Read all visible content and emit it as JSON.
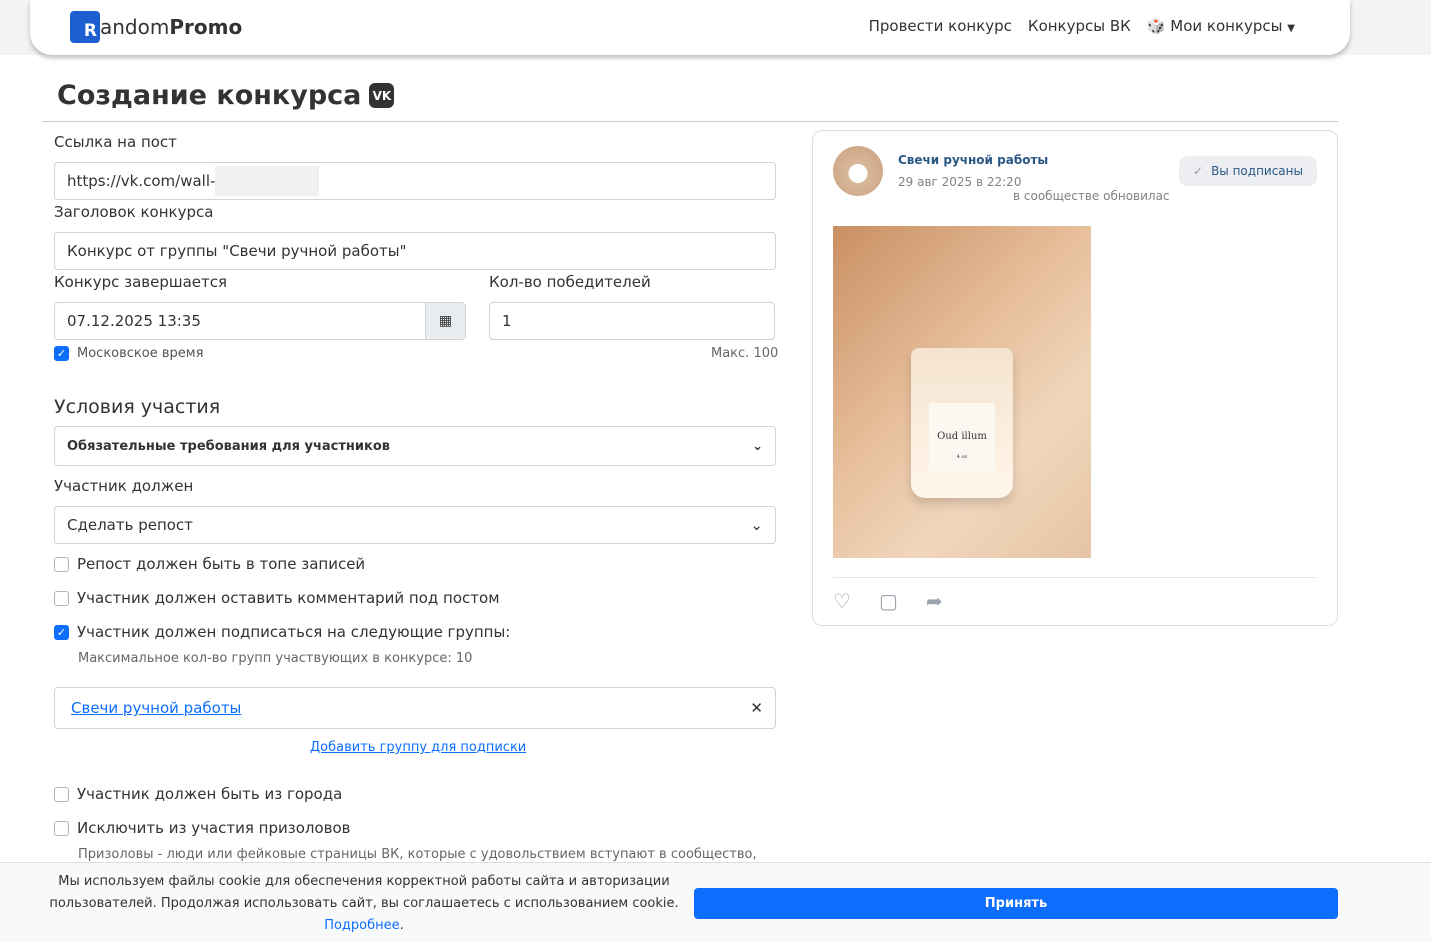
{
  "nav": {
    "logo_prefix": "andom",
    "logo_letter": "R",
    "logo_bold": "Promo",
    "links": [
      "Провести конкурс",
      "Конкурсы ВК",
      "Мои конкурсы"
    ]
  },
  "page": {
    "title": "Создание конкурса",
    "vk_badge": "VK"
  },
  "form": {
    "post_link_label": "Ссылка на пост",
    "post_link_value": "https://vk.com/wall-",
    "title_label": "Заголовок конкурса",
    "title_value": "Конкурс от группы \"Свечи ручной работы\"",
    "end_label": "Конкурс завершается",
    "end_value": "07.12.2025 13:35",
    "winners_label": "Кол-во победителей",
    "winners_value": "1",
    "moscow_time": "Московское время",
    "max_winners": "Макс. 100",
    "conditions_heading": "Условия участия",
    "requirements_select": "Обязательные требования для участников",
    "must_label": "Участник должен",
    "must_select": "Сделать репост",
    "opt_top": "Репост должен быть в топе записей",
    "opt_comment": "Участник должен оставить комментарий под постом",
    "opt_subscribe": "Участник должен подписаться на следующие группы:",
    "max_groups": "Максимальное кол-во групп участвующих в конкурсе: 10",
    "group_name": "Свечи ручной работы",
    "add_group": "Добавить группу для подписки",
    "opt_city": "Участник должен быть из города",
    "opt_prize": "Исключить из участия призоловов",
    "prize_desc": "Призоловы - люди или фейковые страницы ВК, которые с удовольствием вступают в сообщество,"
  },
  "post": {
    "group": "Свечи ручной работы",
    "date": "29 авг 2025 в 22:20",
    "subscribed": "Вы подписаны",
    "text": "в сообществе обновилас",
    "label_text": "Oud illum",
    "label_small": "4 oz"
  },
  "cookie": {
    "text1": "Мы используем файлы cookie для обеспечения корректной работы сайта и авторизации",
    "text2": "пользователей. Продолжая использовать сайт, вы соглашаетесь с использованием cookie.",
    "more": "Подробнее",
    "accept": "Принять"
  }
}
